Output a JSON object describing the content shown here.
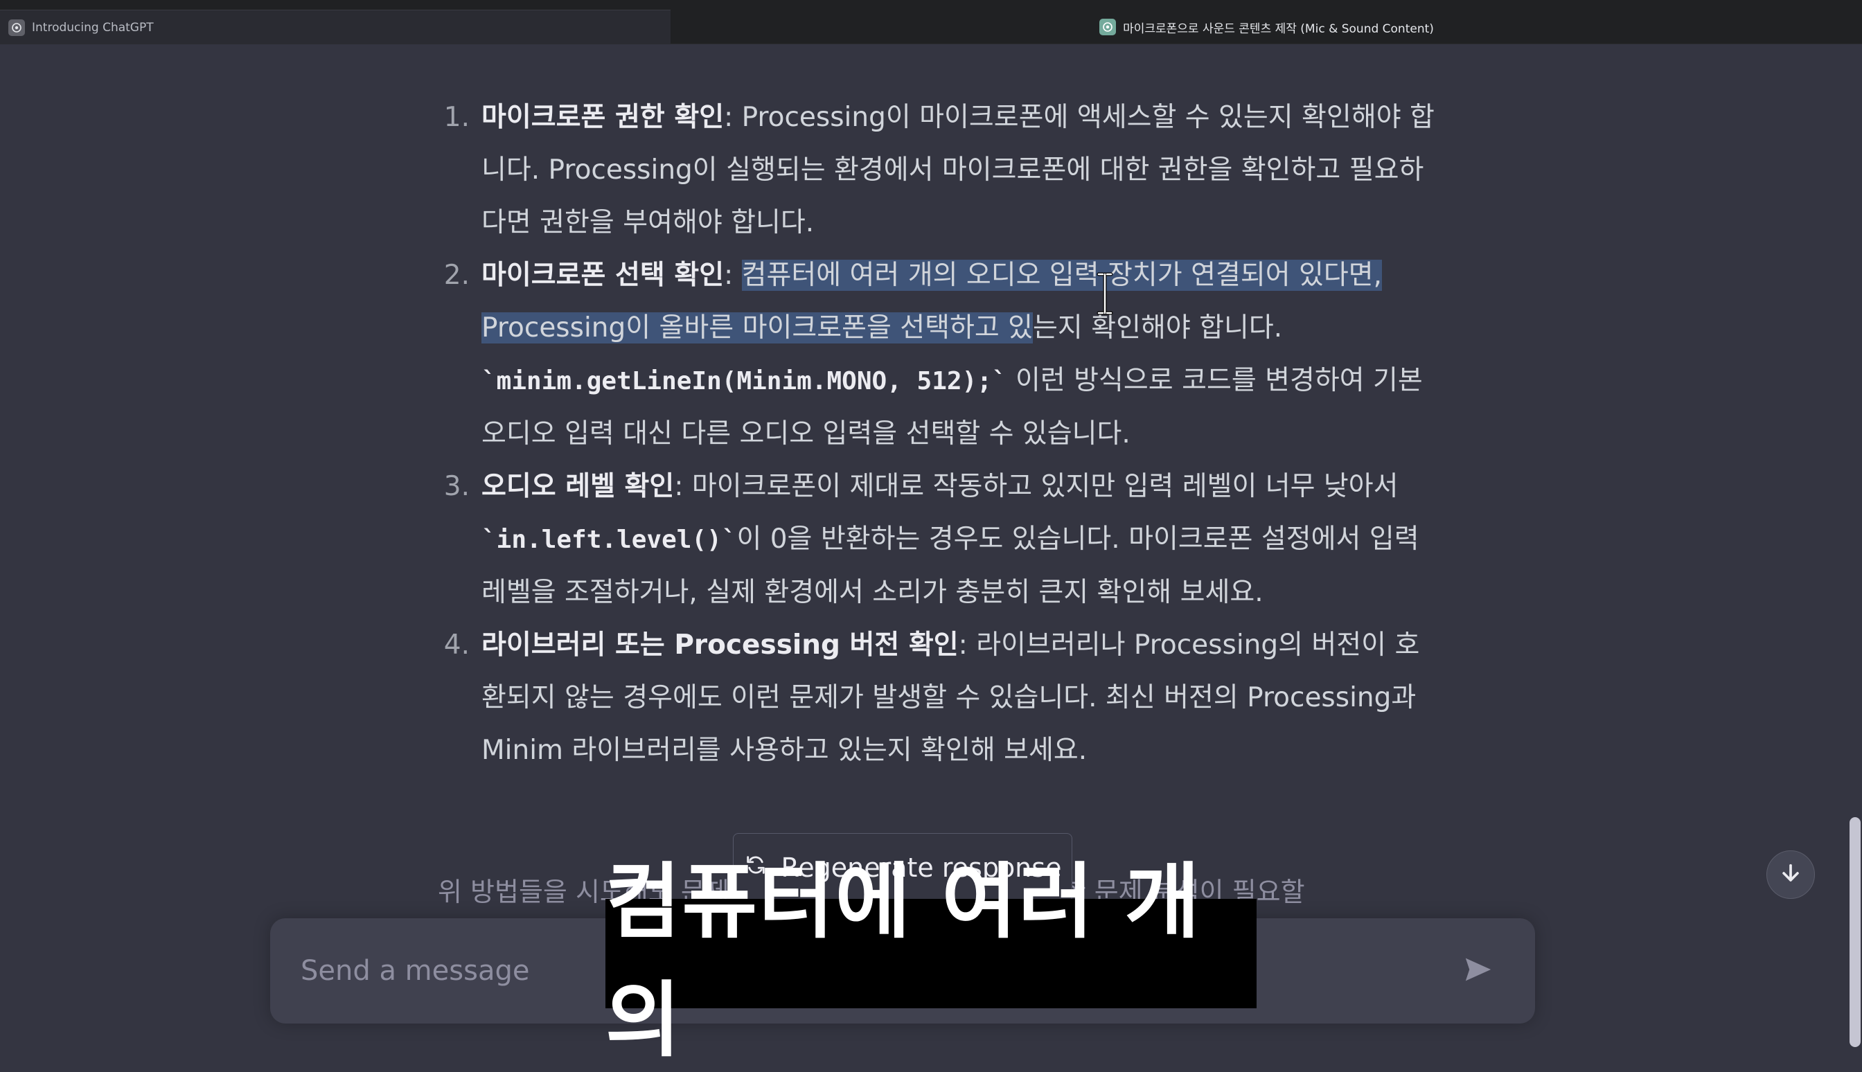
{
  "tabs": [
    {
      "title": "Introducing ChatGPT",
      "icon": "chatgpt-icon"
    },
    {
      "title": "마이크로폰으로 사운드 콘텐츠 제작 (Mic & Sound Content)",
      "icon": "chatgpt-icon"
    }
  ],
  "response": {
    "items": [
      {
        "number": "1.",
        "heading": "마이크로폰 권한 확인",
        "body": ": Processing이 마이크로폰에 액세스할 수 있는지 확인해야 합니다. Processing이 실행되는 환경에서 마이크로폰에 대한 권한을 확인하고 필요하다면 권한을 부여해야 합니다."
      },
      {
        "number": "2.",
        "heading": "마이크로폰 선택 확인",
        "sep": ": ",
        "selected": "컴퓨터에 여러 개의 오디오 입력 장치가 연결되어 있다면, Processing이 올바른 마이크로폰을 선택하고 있",
        "after_selected": "는지 확인해야 합니다.",
        "code": "`minim.getLineIn(Minim.MONO, 512);`",
        "after_code": " 이런 방식으로 코드를 변경하여 기본 오디오 입력 대신 다른 오디오 입력을 선택할 수 있습니다."
      },
      {
        "number": "3.",
        "heading": "오디오 레벨 확인",
        "body_before": ": 마이크로폰이 제대로 작동하고 있지만 입력 레벨이 너무 낮아서 ",
        "code": "`in.left.level()`",
        "body_after": "이 0을 반환하는 경우도 있습니다. 마이크로폰 설정에서 입력 레벨을 조절하거나, 실제 환경에서 소리가 충분히 큰지 확인해 보세요."
      },
      {
        "number": "4.",
        "heading": "라이브러리 또는 Processing 버전 확인",
        "body": ": 라이브러리나 Processing의 버전이 호환되지 않는 경우에도 이런 문제가 발생할 수 있습니다. 최신 버전의 Processing과 Minim 라이브러리를 사용하고 있는지 확인해 보세요."
      }
    ],
    "trailing_text": "위 방법들을 시도해도 문제가 해결되지 않는다면, 더 자세한 문제 분석이 필요할"
  },
  "regenerate": {
    "label": "Regenerate response",
    "icon": "refresh-icon"
  },
  "composer": {
    "placeholder": "Send a message",
    "send_icon": "send-icon"
  },
  "scroll_down": {
    "icon": "arrow-down-icon"
  },
  "subtitle": "컴퓨터에 여러 개의"
}
